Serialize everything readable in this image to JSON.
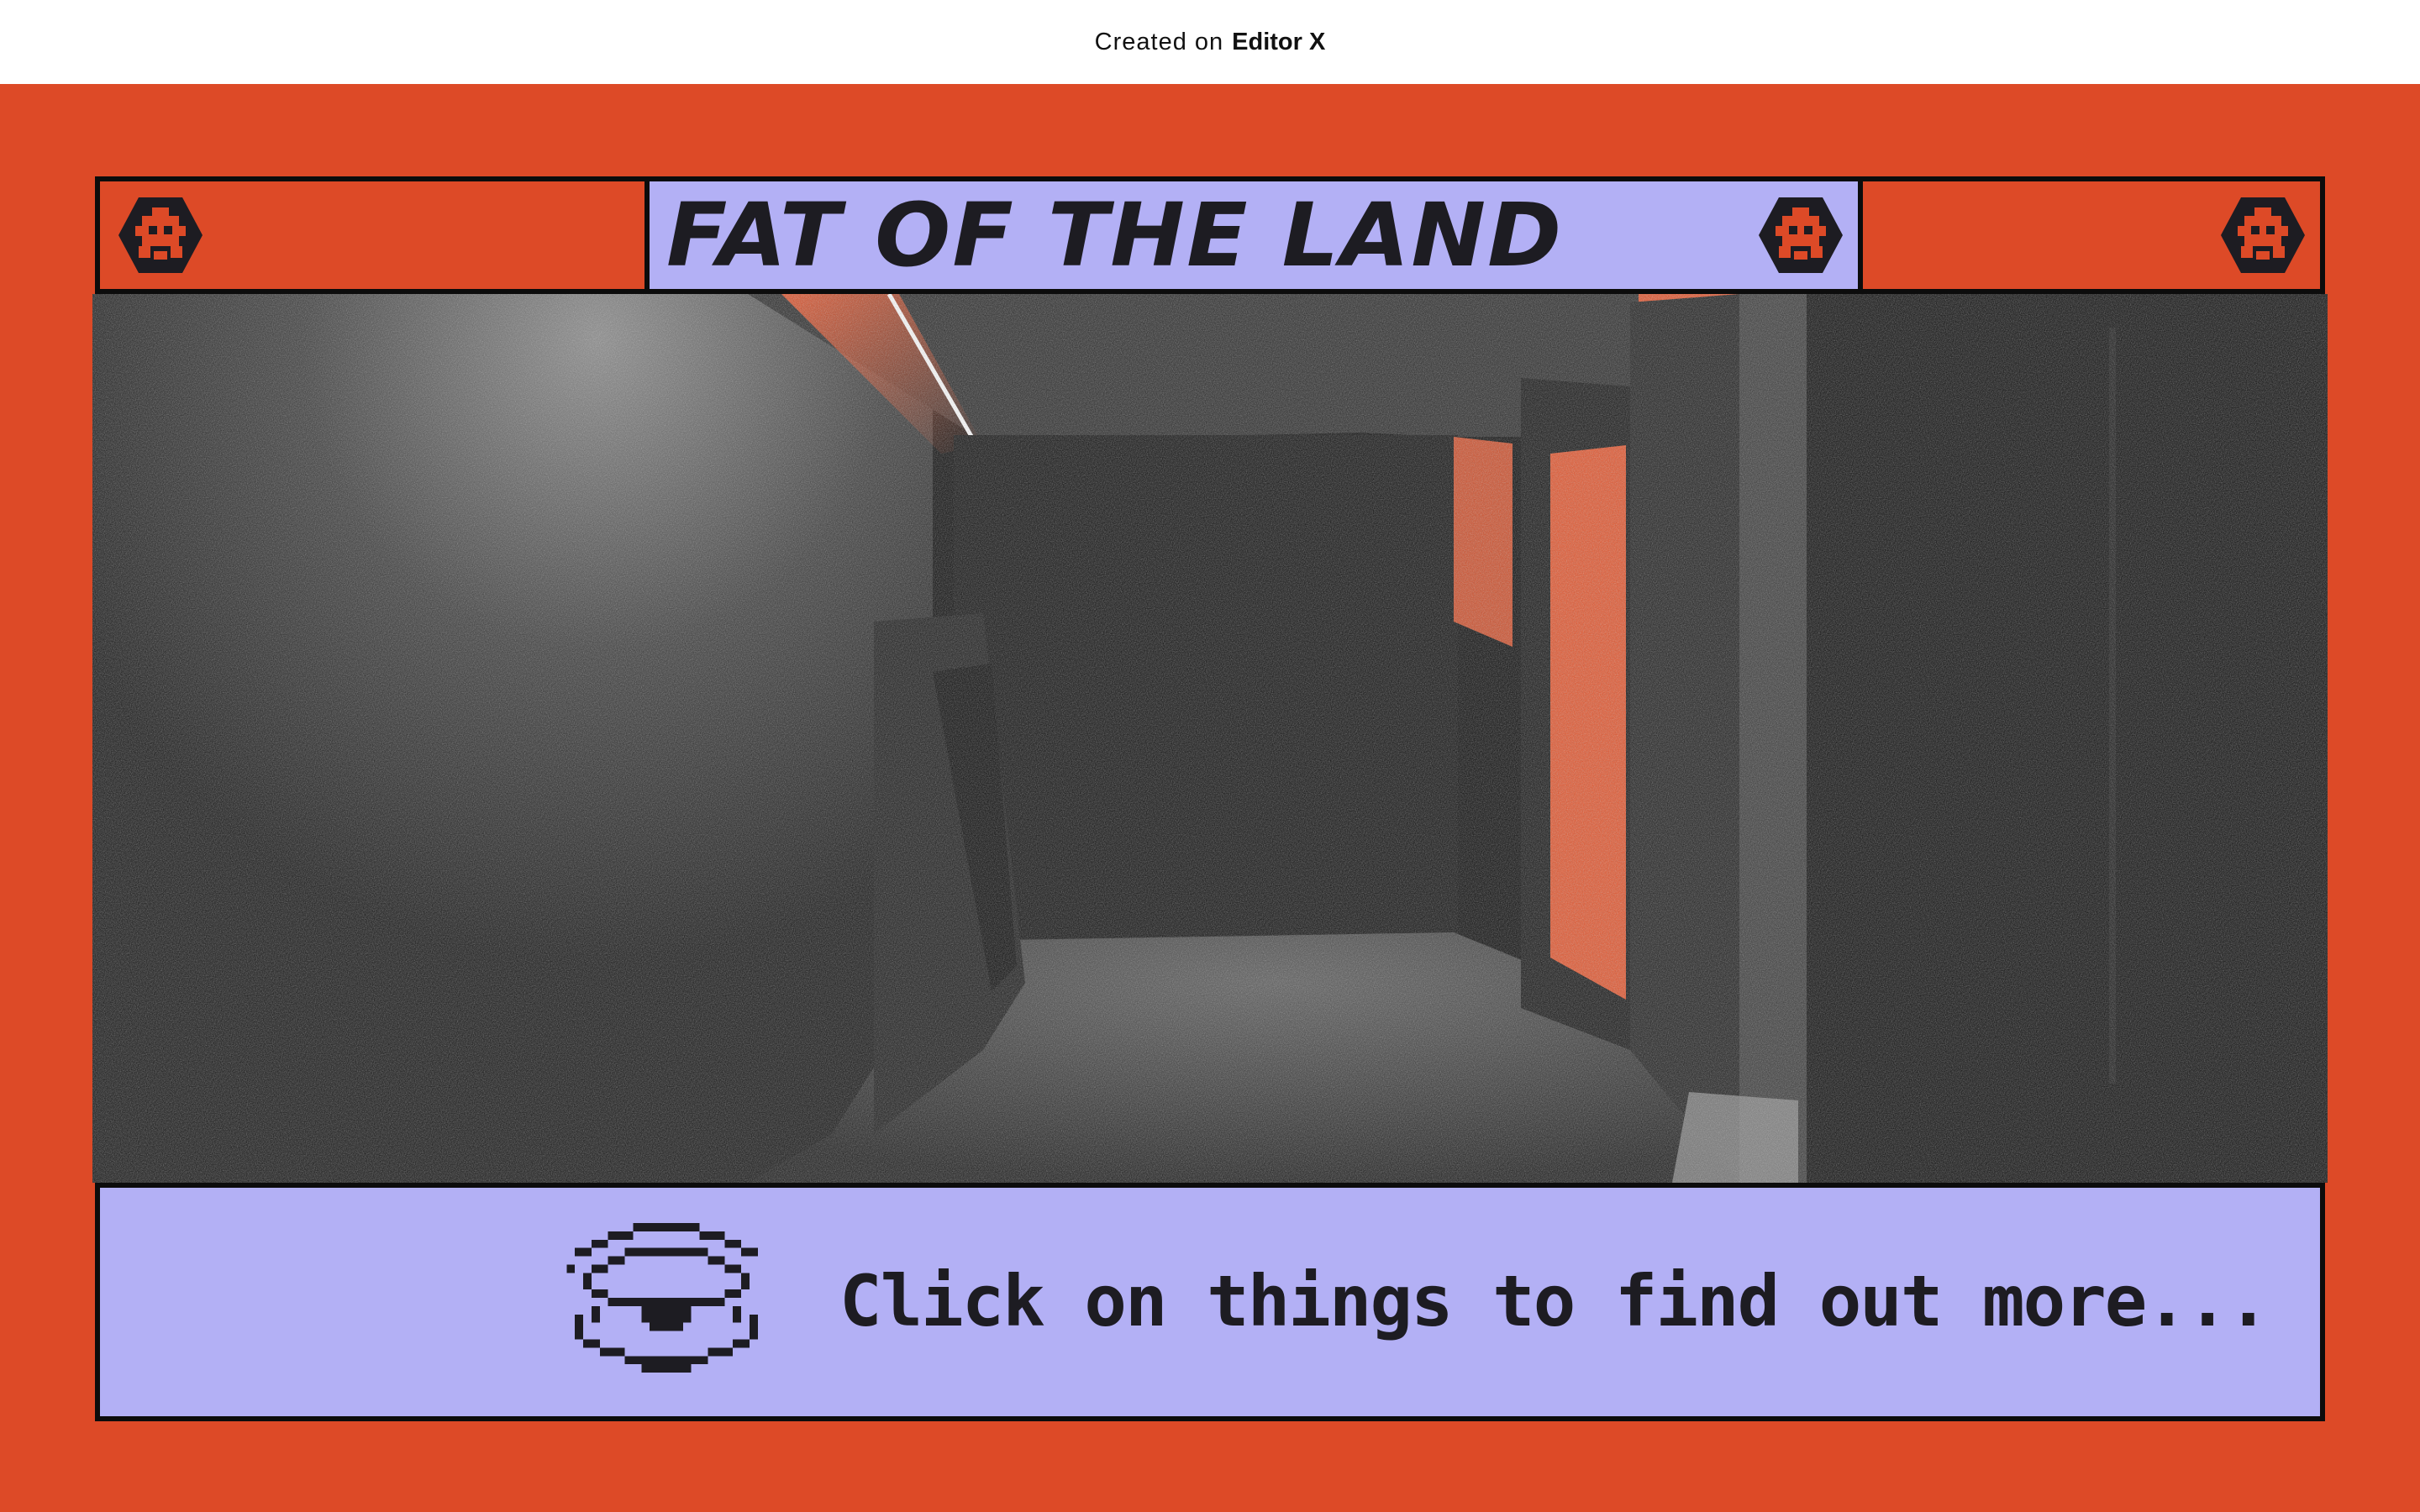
{
  "topbar": {
    "created_label": "Created on",
    "brand": "Editor X"
  },
  "header": {
    "title": "FAT OF THE LAND",
    "badge_icon": "pixel-skull-hexagon-icon"
  },
  "scene": {
    "image": "dark corridor with orange neon light"
  },
  "footer": {
    "icon": "pixel-eye-icon",
    "hint": "Click on things to find out more..."
  },
  "colors": {
    "background": "#dd4a27",
    "panel": "#b3b0f5",
    "ink": "#1d1c22",
    "border": "#0c0c0c"
  }
}
